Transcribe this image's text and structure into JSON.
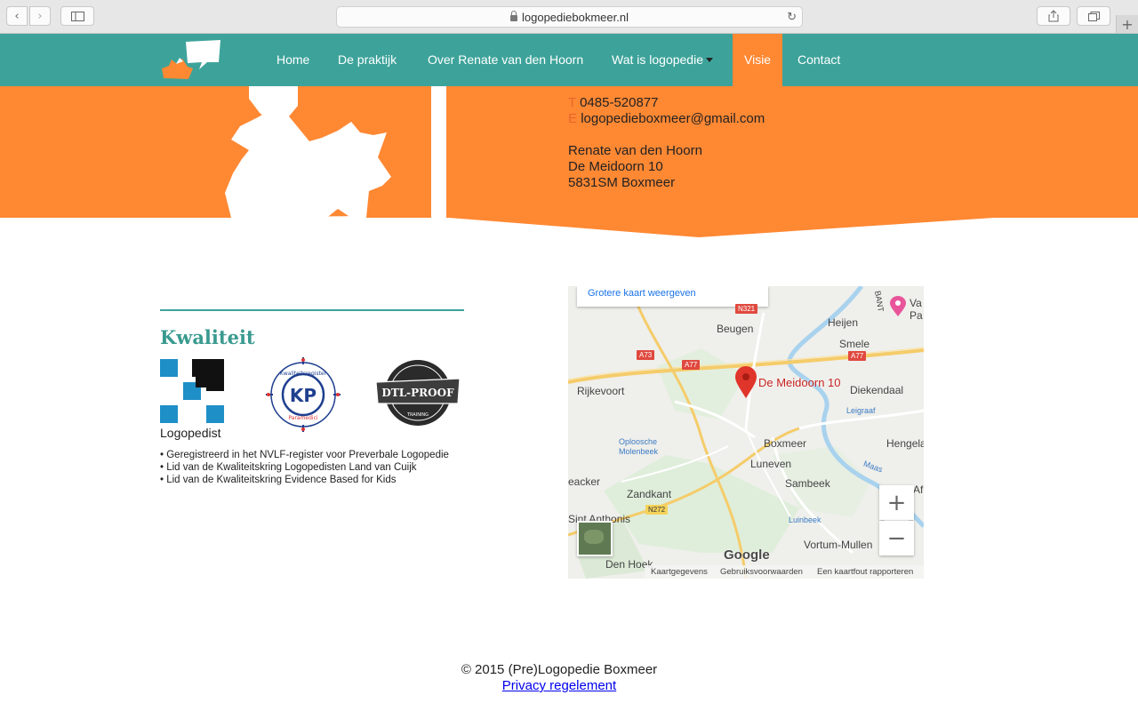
{
  "browser": {
    "url": "logopediebokmeer.nl",
    "new_tab_symbol": "+"
  },
  "nav": {
    "items": [
      "Home",
      "De praktijk",
      "Over Renate van den Hoorn",
      "Wat is logopedie",
      "Visie",
      "Contact"
    ],
    "active": "Visie",
    "accent": "#3da39a",
    "active_color": "#ff8833"
  },
  "contact": {
    "phone_label": "T",
    "phone": "0485-520877",
    "email_label": "E",
    "email": "logopedieboxmeer@gmail.com",
    "name": "Renate van den Hoorn",
    "street": "De Meidoorn 10",
    "city": "5831SM Boxmeer"
  },
  "quality": {
    "title": "Kwaliteit",
    "logo_label": "Logopedist",
    "kp_text": "KP",
    "kp_ring_top": "Kwaliteitsregister",
    "kp_ring_bottom": "Paramedici",
    "dtl_text": "DTL-PROOF",
    "dtl_sub": "TRAINING",
    "bullets": [
      "Geregistreerd in het NVLF-register voor Preverbale Logopedie",
      "Lid van de Kwaliteitskring Logopedisten Land van Cuijk",
      "Lid van de Kwaliteitskring Evidence Based for Kids"
    ]
  },
  "map": {
    "link": "Grotere kaart weergeven",
    "pin_label": "De Meidoorn 10",
    "zoom_in": "+",
    "zoom_out": "−",
    "google": "Google",
    "footer_items": [
      "Kaartgegevens",
      "Gebruiksvoorwaarden",
      "Een kaartfout rapporteren"
    ],
    "places": [
      "Beugen",
      "Heijen",
      "Smele",
      "Rijkevoort",
      "Diekendaal",
      "Leigraaf",
      "Oploosche",
      "Molenbeek",
      "Boxmeer",
      "Hengela",
      "Luneven",
      "Maas",
      "eacker",
      "Zandkant",
      "Sambeek",
      "Sint Anthonis",
      "Luinbeek",
      "Vortum-Mullen",
      "Den Hoek",
      "BANT",
      "Va",
      "Pa",
      "Af"
    ],
    "roads": [
      "A73",
      "A77",
      "A77",
      "N272",
      "N321"
    ]
  },
  "footer": {
    "copyright": "© 2015 (Pre)Logopedie Boxmeer",
    "privacy": "Privacy regelement"
  }
}
